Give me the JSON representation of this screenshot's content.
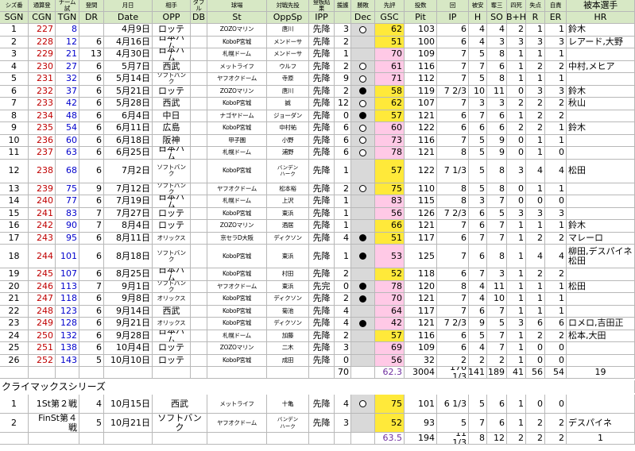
{
  "columns_en": [
    "SGN",
    "CGN",
    "TGN",
    "DR",
    "Date",
    "OPP",
    "DB",
    "St",
    "OppSp",
    "IPP",
    "",
    "Dec",
    "GSC",
    "Pit",
    "IP",
    "H",
    "SO",
    "B+H",
    "R",
    "ER",
    "HR"
  ],
  "columns_jp": [
    "シズ番",
    "通算登",
    "チーム試",
    "登間",
    "月日",
    "相手",
    "ダブル",
    "球場",
    "対戦先投",
    "登板結果",
    "援護",
    "勝敗",
    "先評",
    "投数",
    "回",
    "被安",
    "奪三",
    "四死",
    "失点",
    "自責",
    "被本選手"
  ],
  "rows": [
    {
      "sgn": "1",
      "cgn": "227",
      "tgn": "8",
      "dr": "",
      "date": "4月9日",
      "opp": "ロッテ",
      "db": "",
      "st": "ZOZOマリン",
      "opp_sp": "唐川",
      "ipp": "先降",
      "sup": "3",
      "dec": "open",
      "gsc": "62",
      "pit": "103",
      "ip": "6",
      "h": "4",
      "so": "4",
      "bh": "2",
      "r": "1",
      "er": "1",
      "hr": "鈴木"
    },
    {
      "sgn": "2",
      "cgn": "228",
      "tgn": "12",
      "dr": "6",
      "date": "4月16日",
      "opp": "日本ハム",
      "db": "",
      "st": "KoboP宮城",
      "opp_sp": "メンドーサ",
      "ipp": "先降",
      "sup": "2",
      "dec": "",
      "gsc": "51",
      "pit": "100",
      "ip": "6",
      "h": "4",
      "so": "3",
      "bh": "3",
      "r": "3",
      "er": "3",
      "hr": "レアード,大野"
    },
    {
      "sgn": "3",
      "cgn": "229",
      "tgn": "21",
      "dr": "13",
      "date": "4月30日",
      "opp": "日本ハム",
      "db": "",
      "st": "札幌ドーム",
      "opp_sp": "メンドーサ",
      "ipp": "先降",
      "sup": "1",
      "dec": "",
      "gsc": "70",
      "pit": "109",
      "ip": "7",
      "h": "5",
      "so": "8",
      "bh": "1",
      "r": "1",
      "er": "1",
      "hr": ""
    },
    {
      "sgn": "4",
      "cgn": "230",
      "tgn": "27",
      "dr": "6",
      "date": "5月7日",
      "opp": "西武",
      "db": "",
      "st": "メットライフ",
      "opp_sp": "ウルフ",
      "ipp": "先降",
      "sup": "2",
      "dec": "open",
      "gsc": "61",
      "pit": "116",
      "ip": "7",
      "h": "7",
      "so": "6",
      "bh": "1",
      "r": "2",
      "er": "2",
      "hr": "中村,メヒア"
    },
    {
      "sgn": "5",
      "cgn": "231",
      "tgn": "32",
      "dr": "6",
      "date": "5月14日",
      "opp": "ソフトバンク",
      "db": "",
      "st": "ヤフオクドーム",
      "opp_sp": "寺原",
      "ipp": "先降",
      "sup": "9",
      "dec": "open",
      "gsc": "71",
      "pit": "112",
      "ip": "7",
      "h": "5",
      "so": "8",
      "bh": "1",
      "r": "1",
      "er": "1",
      "hr": ""
    },
    {
      "sgn": "6",
      "cgn": "232",
      "tgn": "37",
      "dr": "6",
      "date": "5月21日",
      "opp": "ロッテ",
      "db": "",
      "st": "ZOZOマリン",
      "opp_sp": "唐川",
      "ipp": "先降",
      "sup": "2",
      "dec": "fill",
      "gsc": "58",
      "pit": "119",
      "ip": "7 2/3",
      "h": "10",
      "so": "11",
      "bh": "0",
      "r": "3",
      "er": "3",
      "hr": "鈴木"
    },
    {
      "sgn": "7",
      "cgn": "233",
      "tgn": "42",
      "dr": "6",
      "date": "5月28日",
      "opp": "西武",
      "db": "",
      "st": "KoboP宮城",
      "opp_sp": "誠",
      "ipp": "先降",
      "sup": "12",
      "dec": "open",
      "gsc": "62",
      "pit": "107",
      "ip": "7",
      "h": "3",
      "so": "3",
      "bh": "2",
      "r": "2",
      "er": "2",
      "hr": "秋山"
    },
    {
      "sgn": "8",
      "cgn": "234",
      "tgn": "48",
      "dr": "6",
      "date": "6月4日",
      "opp": "中日",
      "db": "",
      "st": "ナゴヤドーム",
      "opp_sp": "ジョーダン",
      "ipp": "先降",
      "sup": "0",
      "dec": "fill",
      "gsc": "57",
      "pit": "121",
      "ip": "6",
      "h": "7",
      "so": "6",
      "bh": "1",
      "r": "2",
      "er": "2",
      "hr": ""
    },
    {
      "sgn": "9",
      "cgn": "235",
      "tgn": "54",
      "dr": "6",
      "date": "6月11日",
      "opp": "広島",
      "db": "",
      "st": "KoboP宮城",
      "opp_sp": "中村祐",
      "ipp": "先降",
      "sup": "6",
      "dec": "open",
      "gsc": "60",
      "pit": "122",
      "ip": "6",
      "h": "6",
      "so": "6",
      "bh": "2",
      "r": "2",
      "er": "1",
      "hr": "鈴木"
    },
    {
      "sgn": "10",
      "cgn": "236",
      "tgn": "60",
      "dr": "6",
      "date": "6月18日",
      "opp": "阪神",
      "db": "",
      "st": "甲子園",
      "opp_sp": "小野",
      "ipp": "先降",
      "sup": "6",
      "dec": "open",
      "gsc": "73",
      "pit": "116",
      "ip": "7",
      "h": "5",
      "so": "9",
      "bh": "0",
      "r": "1",
      "er": "1",
      "hr": ""
    },
    {
      "sgn": "11",
      "cgn": "237",
      "tgn": "63",
      "dr": "6",
      "date": "6月25日",
      "opp": "日本ハム",
      "db": "",
      "st": "札幌ドーム",
      "opp_sp": "浦野",
      "ipp": "先降",
      "sup": "6",
      "dec": "open",
      "gsc": "78",
      "pit": "121",
      "ip": "8",
      "h": "5",
      "so": "9",
      "bh": "0",
      "r": "1",
      "er": "0",
      "hr": ""
    },
    {
      "sgn": "12",
      "cgn": "238",
      "tgn": "68",
      "dr": "6",
      "date": "7月2日",
      "opp": "ソフトバンク",
      "db": "",
      "st": "KoboP宮城",
      "opp_sp": "バンデン\nハーク",
      "ipp": "先降",
      "sup": "1",
      "dec": "",
      "gsc": "57",
      "pit": "122",
      "ip": "7 1/3",
      "h": "5",
      "so": "8",
      "bh": "3",
      "r": "4",
      "er": "4",
      "hr": "松田"
    },
    {
      "sgn": "13",
      "cgn": "239",
      "tgn": "75",
      "dr": "9",
      "date": "7月12日",
      "opp": "ソフトバンク",
      "db": "",
      "st": "ヤフオクドーム",
      "opp_sp": "松本裕",
      "ipp": "先降",
      "sup": "2",
      "dec": "open",
      "gsc": "75",
      "pit": "110",
      "ip": "8",
      "h": "5",
      "so": "8",
      "bh": "0",
      "r": "1",
      "er": "1",
      "hr": ""
    },
    {
      "sgn": "14",
      "cgn": "240",
      "tgn": "77",
      "dr": "6",
      "date": "7月19日",
      "opp": "日本ハム",
      "db": "",
      "st": "札幌ドーム",
      "opp_sp": "上沢",
      "ipp": "先降",
      "sup": "1",
      "dec": "",
      "gsc": "83",
      "pit": "115",
      "ip": "8",
      "h": "3",
      "so": "7",
      "bh": "0",
      "r": "0",
      "er": "0",
      "hr": ""
    },
    {
      "sgn": "15",
      "cgn": "241",
      "tgn": "83",
      "dr": "7",
      "date": "7月27日",
      "opp": "ロッテ",
      "db": "",
      "st": "KoboP宮城",
      "opp_sp": "東浜",
      "ipp": "先降",
      "sup": "1",
      "dec": "",
      "gsc": "56",
      "pit": "126",
      "ip": "7 2/3",
      "h": "6",
      "so": "5",
      "bh": "3",
      "r": "3",
      "er": "3",
      "hr": ""
    },
    {
      "sgn": "16",
      "cgn": "242",
      "tgn": "90",
      "dr": "7",
      "date": "8月4日",
      "opp": "ロッテ",
      "db": "",
      "st": "ZOZOマリン",
      "opp_sp": "酒居",
      "ipp": "先降",
      "sup": "1",
      "dec": "",
      "gsc": "66",
      "pit": "121",
      "ip": "7",
      "h": "6",
      "so": "7",
      "bh": "1",
      "r": "1",
      "er": "1",
      "hr": "鈴木"
    },
    {
      "sgn": "17",
      "cgn": "243",
      "tgn": "95",
      "dr": "6",
      "date": "8月11日",
      "opp": "オリックス",
      "db": "",
      "st": "京セラD大阪",
      "opp_sp": "ディクソン",
      "ipp": "先降",
      "sup": "4",
      "dec": "fill",
      "gsc": "51",
      "pit": "117",
      "ip": "6",
      "h": "7",
      "so": "7",
      "bh": "1",
      "r": "2",
      "er": "2",
      "hr": "マレーロ"
    },
    {
      "sgn": "18",
      "cgn": "244",
      "tgn": "101",
      "dr": "6",
      "date": "8月18日",
      "opp": "ソフトバンク",
      "db": "",
      "st": "KoboP宮城",
      "opp_sp": "東浜",
      "ipp": "先降",
      "sup": "1",
      "dec": "fill",
      "gsc": "53",
      "pit": "125",
      "ip": "7",
      "h": "6",
      "so": "8",
      "bh": "1",
      "r": "4",
      "er": "4",
      "hr": "柳田,デスパイネ\n松田"
    },
    {
      "sgn": "19",
      "cgn": "245",
      "tgn": "107",
      "dr": "6",
      "date": "8月25日",
      "opp": "日本ハム",
      "db": "",
      "st": "KoboP宮城",
      "opp_sp": "村田",
      "ipp": "先降",
      "sup": "2",
      "dec": "",
      "gsc": "52",
      "pit": "118",
      "ip": "6",
      "h": "7",
      "so": "3",
      "bh": "1",
      "r": "2",
      "er": "2",
      "hr": ""
    },
    {
      "sgn": "20",
      "cgn": "246",
      "tgn": "113",
      "dr": "7",
      "date": "9月1日",
      "opp": "ソフトバンク",
      "db": "",
      "st": "ヤフオクドーム",
      "opp_sp": "東浜",
      "ipp": "先完",
      "sup": "0",
      "dec": "fill",
      "gsc": "78",
      "pit": "120",
      "ip": "8",
      "h": "4",
      "so": "11",
      "bh": "1",
      "r": "1",
      "er": "1",
      "hr": "松田"
    },
    {
      "sgn": "21",
      "cgn": "247",
      "tgn": "118",
      "dr": "6",
      "date": "9月8日",
      "opp": "オリックス",
      "db": "",
      "st": "KoboP宮城",
      "opp_sp": "ディクソン",
      "ipp": "先降",
      "sup": "2",
      "dec": "fill",
      "gsc": "70",
      "pit": "121",
      "ip": "7",
      "h": "4",
      "so": "10",
      "bh": "1",
      "r": "1",
      "er": "1",
      "hr": ""
    },
    {
      "sgn": "22",
      "cgn": "248",
      "tgn": "123",
      "dr": "6",
      "date": "9月14日",
      "opp": "西武",
      "db": "",
      "st": "KoboP宮城",
      "opp_sp": "菊池",
      "ipp": "先降",
      "sup": "4",
      "dec": "",
      "gsc": "64",
      "pit": "117",
      "ip": "7",
      "h": "6",
      "so": "7",
      "bh": "1",
      "r": "1",
      "er": "1",
      "hr": ""
    },
    {
      "sgn": "23",
      "cgn": "249",
      "tgn": "128",
      "dr": "6",
      "date": "9月21日",
      "opp": "オリックス",
      "db": "",
      "st": "KoboP宮城",
      "opp_sp": "ディクソン",
      "ipp": "先降",
      "sup": "4",
      "dec": "fill",
      "gsc": "42",
      "pit": "121",
      "ip": "7 2/3",
      "h": "9",
      "so": "5",
      "bh": "3",
      "r": "6",
      "er": "6",
      "hr": "ロメロ,吉田正"
    },
    {
      "sgn": "24",
      "cgn": "250",
      "tgn": "132",
      "dr": "6",
      "date": "9月28日",
      "opp": "日本ハム",
      "db": "",
      "st": "札幌ドーム",
      "opp_sp": "加藤",
      "ipp": "先降",
      "sup": "2",
      "dec": "",
      "gsc": "57",
      "pit": "116",
      "ip": "6",
      "h": "5",
      "so": "7",
      "bh": "1",
      "r": "2",
      "er": "2",
      "hr": "松本,大田"
    },
    {
      "sgn": "25",
      "cgn": "251",
      "tgn": "138",
      "dr": "6",
      "date": "10月4日",
      "opp": "ロッテ",
      "db": "",
      "st": "ZOZOマリン",
      "opp_sp": "二木",
      "ipp": "先降",
      "sup": "3",
      "dec": "",
      "gsc": "69",
      "pit": "109",
      "ip": "6",
      "h": "4",
      "so": "7",
      "bh": "1",
      "r": "0",
      "er": "0",
      "hr": ""
    },
    {
      "sgn": "26",
      "cgn": "252",
      "tgn": "143",
      "dr": "5",
      "date": "10月10日",
      "opp": "ロッテ",
      "db": "",
      "st": "KoboP宮城",
      "opp_sp": "成田",
      "ipp": "先降",
      "sup": "0",
      "dec": "",
      "gsc": "56",
      "pit": "32",
      "ip": "2",
      "h": "2",
      "so": "2",
      "bh": "1",
      "r": "0",
      "er": "0",
      "hr": ""
    }
  ],
  "totals": {
    "sup": "70",
    "gsc": "62.3",
    "pit": "3004",
    "ip": "176 1/3",
    "h": "141",
    "so": "189",
    "bh": "41",
    "r": "56",
    "er": "54",
    "hr": "19"
  },
  "section_title": "クライマックスシリーズ",
  "cs_rows": [
    {
      "sgn": "1",
      "cgn": "1St第２戦",
      "dr": "4",
      "date": "10月15日",
      "opp": "西武",
      "st": "メットライフ",
      "opp_sp": "十亀",
      "ipp": "先降",
      "sup": "4",
      "dec": "open",
      "gsc": "75",
      "pit": "101",
      "ip": "6 1/3",
      "h": "5",
      "so": "6",
      "bh": "1",
      "r": "0",
      "er": "0",
      "hr": ""
    },
    {
      "sgn": "2",
      "cgn": "FinSt第４戦",
      "dr": "5",
      "date": "10月21日",
      "opp": "ソフトバンク",
      "st": "ヤフオクドーム",
      "opp_sp": "バンデン\nハーク",
      "ipp": "先降",
      "sup": "3",
      "dec": "",
      "gsc": "52",
      "pit": "93",
      "ip": "5",
      "h": "7",
      "so": "6",
      "bh": "1",
      "r": "2",
      "er": "2",
      "hr": "デスパイネ"
    }
  ],
  "cs_totals": {
    "gsc": "63.5",
    "pit": "194",
    "ip": "11 1/3",
    "h": "8",
    "so": "12",
    "bh": "2",
    "r": "2",
    "er": "2",
    "hr": "1"
  },
  "colors": {
    "header_green": "#d7e8c5",
    "gsc_gold": "#ffe93a",
    "gsc_pink": "#ffc9e6",
    "dec_grey": "#d9d9d9",
    "dec_green": "#b8d99c",
    "dec_red": "#f2b8a8",
    "cgn_red": "#c00000",
    "tgn_blue": "#0000cc"
  }
}
